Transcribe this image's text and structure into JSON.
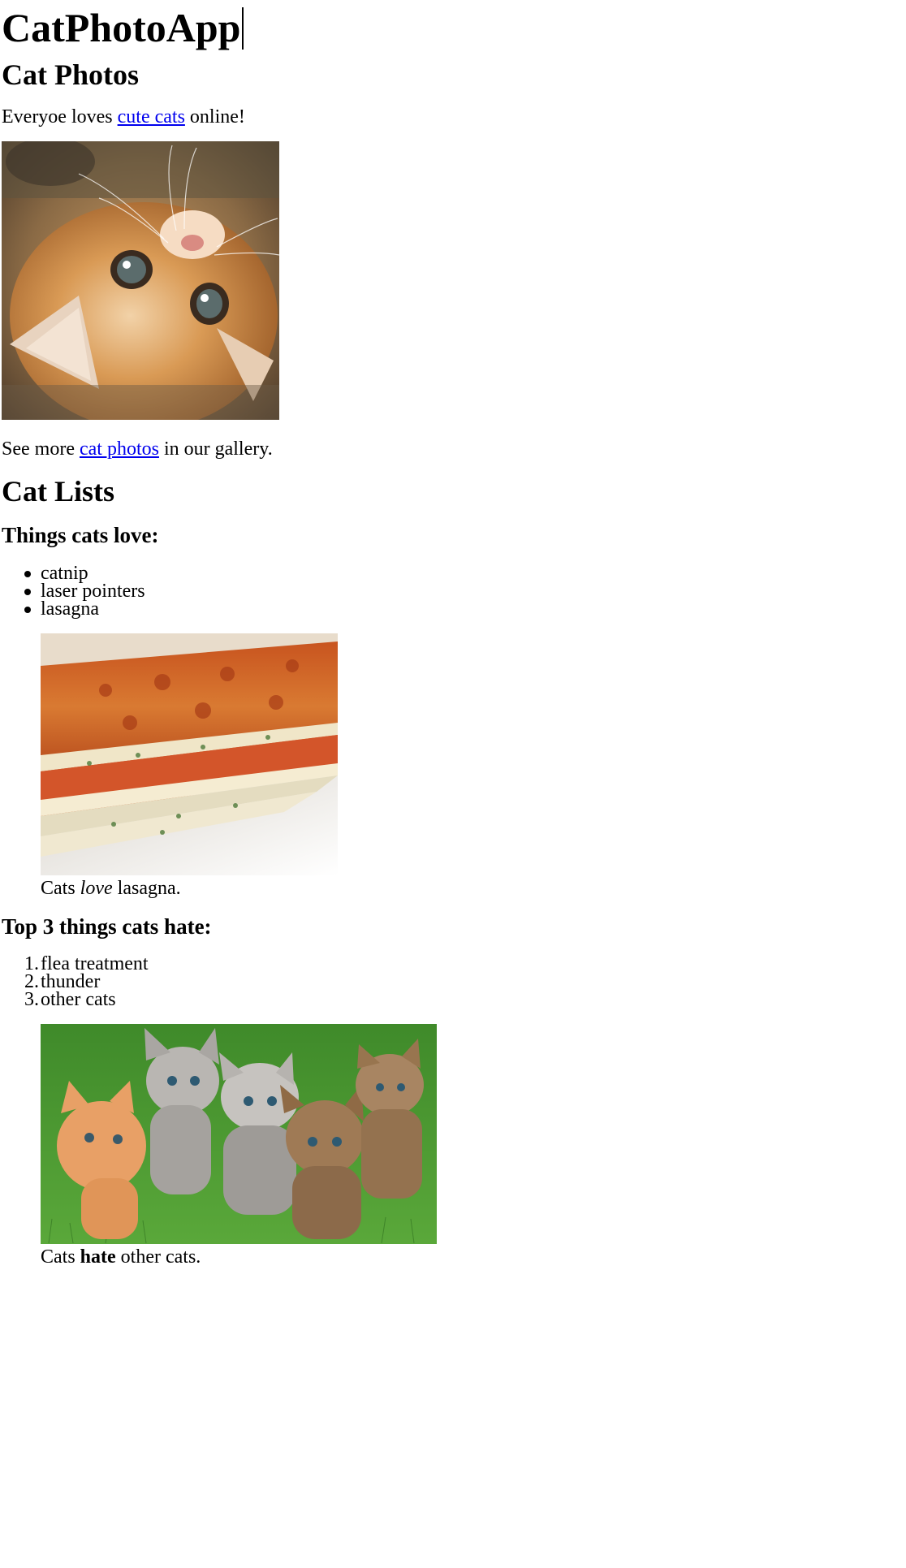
{
  "header": {
    "title": "CatPhotoApp"
  },
  "photos_section": {
    "heading": "Cat Photos",
    "intro_before": "Everyoe loves ",
    "intro_link": "cute cats",
    "intro_after": " online!",
    "kitten_image_alt": "A cute orange cat lying on its back.",
    "gallery_before": "See more ",
    "gallery_link": "cat photos",
    "gallery_after": " in our gallery."
  },
  "lists_section": {
    "heading": "Cat Lists",
    "love": {
      "heading": "Things cats love:",
      "items": [
        "catnip",
        "laser pointers",
        "lasagna"
      ],
      "image_alt": "A slice of lasagna on a plate.",
      "caption_before": "Cats ",
      "caption_emphasis": "love",
      "caption_after": " lasagna."
    },
    "hate": {
      "heading": "Top 3 things cats hate:",
      "items": [
        "flea treatment",
        "thunder",
        "other cats"
      ],
      "numbers": [
        "1.",
        "2.",
        "3."
      ],
      "image_alt": "Five cats looking around a field.",
      "caption_before": "Cats ",
      "caption_strong": "hate",
      "caption_after": " other cats."
    }
  },
  "colors": {
    "link": "#0000ee",
    "text": "#000000",
    "background": "#ffffff"
  }
}
